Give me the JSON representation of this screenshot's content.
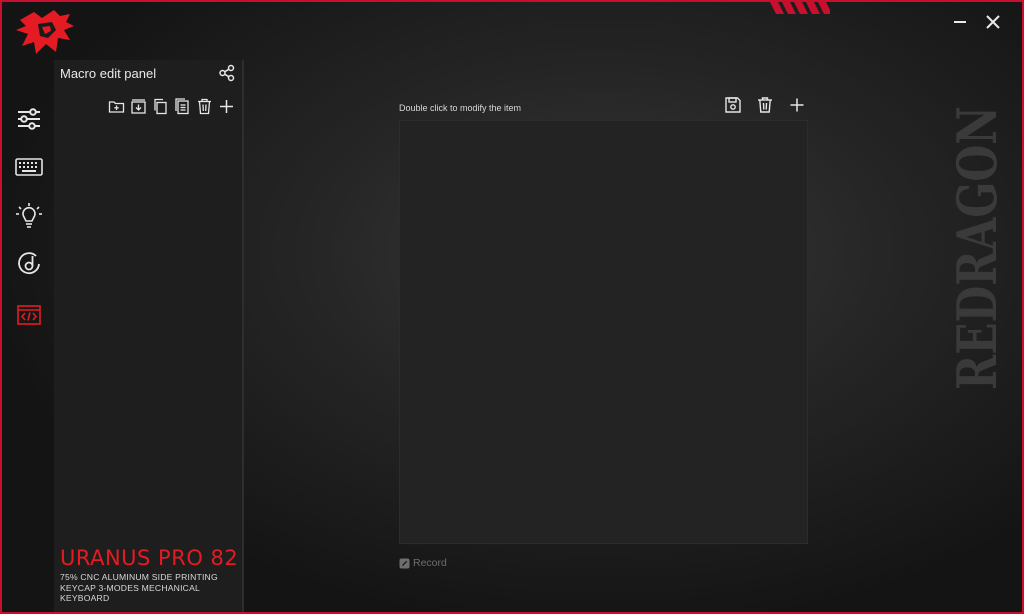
{
  "app": {
    "brand": "REDRAGON",
    "accent_color": "#e41b23"
  },
  "window_controls": {
    "minimize": "minimize-icon",
    "close": "close-icon"
  },
  "sidebar": {
    "items": [
      {
        "icon": "sliders-icon",
        "active": false
      },
      {
        "icon": "keyboard-icon",
        "active": false
      },
      {
        "icon": "lightbulb-icon",
        "active": false
      },
      {
        "icon": "music-disc-icon",
        "active": false
      },
      {
        "icon": "macro-code-icon",
        "active": true
      }
    ]
  },
  "macro_panel": {
    "title": "Macro edit panel",
    "tools": [
      "new-folder-icon",
      "import-icon",
      "copy-icon",
      "paste-icon",
      "delete-icon",
      "add-icon"
    ]
  },
  "product": {
    "name": "URANUS PRO 82",
    "desc_line1": "75% CNC ALUMINUM SIDE PRINTING",
    "desc_line2": "KEYCAP 3-MODES MECHANICAL KEYBOARD"
  },
  "editor": {
    "hint": "Double click to modify the item",
    "record_label": "Record",
    "tools": [
      "save-icon",
      "delete-icon",
      "add-icon"
    ]
  }
}
